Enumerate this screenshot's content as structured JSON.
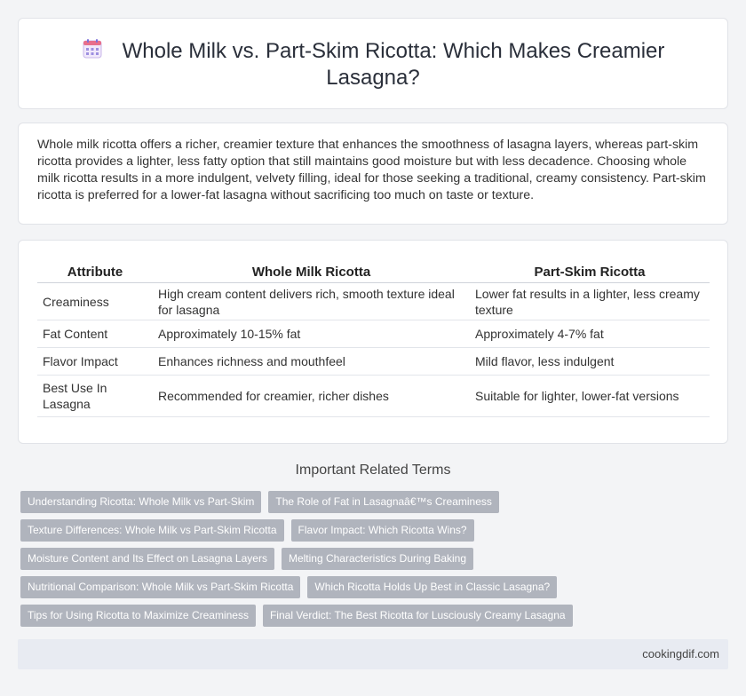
{
  "header": {
    "icon": "calendar-icon",
    "title": "Whole Milk vs. Part-Skim Ricotta: Which Makes Creamier Lasagna?"
  },
  "intro": {
    "text": "Whole milk ricotta offers a richer, creamier texture that enhances the smoothness of lasagna layers, whereas part-skim ricotta provides a lighter, less fatty option that still maintains good moisture but with less decadence. Choosing whole milk ricotta results in a more indulgent, velvety filling, ideal for those seeking a traditional, creamy consistency. Part-skim ricotta is preferred for a lower-fat lasagna without sacrificing too much on taste or texture."
  },
  "table": {
    "headers": [
      "Attribute",
      "Whole Milk Ricotta",
      "Part-Skim Ricotta"
    ],
    "rows": [
      [
        "Creaminess",
        "High cream content delivers rich, smooth texture ideal for lasagna",
        "Lower fat results in a lighter, less creamy texture"
      ],
      [
        "Fat Content",
        "Approximately 10-15% fat",
        "Approximately 4-7% fat"
      ],
      [
        "Flavor Impact",
        "Enhances richness and mouthfeel",
        "Mild flavor, less indulgent"
      ],
      [
        "Best Use In Lasagna",
        "Recommended for creamier, richer dishes",
        "Suitable for lighter, lower-fat versions"
      ]
    ]
  },
  "related": {
    "title": "Important Related Terms",
    "tags": [
      [
        "Understanding Ricotta: Whole Milk vs Part-Skim",
        "The Role of Fat in Lasagnaâ€™s Creaminess"
      ],
      [
        "Texture Differences: Whole Milk vs Part-Skim Ricotta",
        "Flavor Impact: Which Ricotta Wins?"
      ],
      [
        "Moisture Content and Its Effect on Lasagna Layers",
        "Melting Characteristics During Baking"
      ],
      [
        "Nutritional Comparison: Whole Milk vs Part-Skim Ricotta",
        "Which Ricotta Holds Up Best in Classic Lasagna?"
      ],
      [
        "Tips for Using Ricotta to Maximize Creaminess",
        "Final Verdict: The Best Ricotta for Lusciously Creamy Lasagna"
      ]
    ]
  },
  "footer": {
    "site": "cookingdif.com"
  },
  "colors": {
    "background": "#f3f4f6",
    "card": "#ffffff",
    "tag": "#b0b4bd",
    "footer": "#e8ebf2"
  }
}
